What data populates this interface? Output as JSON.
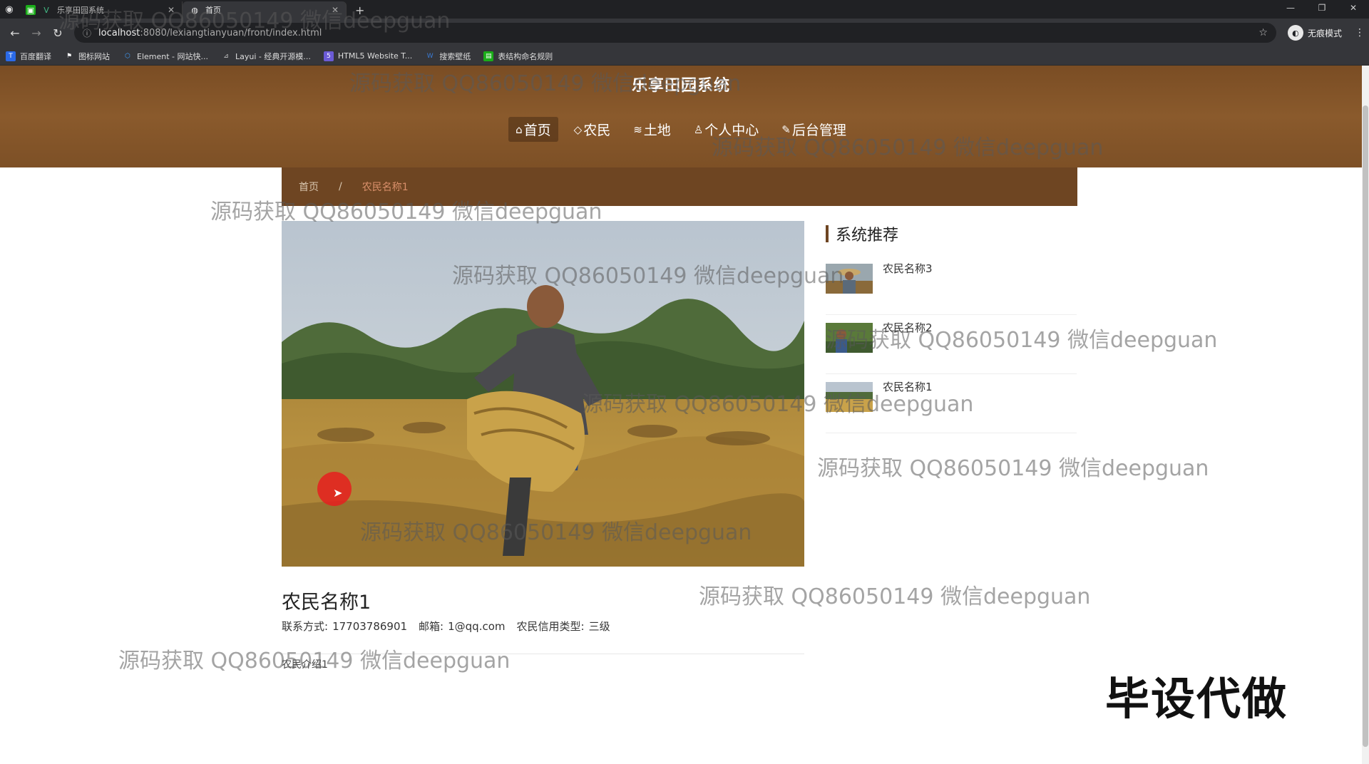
{
  "browser": {
    "tabs": [
      {
        "title": "乐享田园系统",
        "active": false
      },
      {
        "title": "首页",
        "active": true
      }
    ],
    "url_host": "localhost",
    "url_path": ":8080/lexiangtianyuan/front/index.html",
    "profile_label": "无痕模式",
    "bookmarks": [
      {
        "label": "百度翻译",
        "color": "#2a6ae8"
      },
      {
        "label": "图标网站",
        "color": "#444444"
      },
      {
        "label": "Element - 网站快...",
        "color": "#409eff"
      },
      {
        "label": "Layui - 经典开源模...",
        "color": "#555555"
      },
      {
        "label": "HTML5 Website T...",
        "color": "#6b5bd6"
      },
      {
        "label": "搜索壁纸",
        "color": "#3a7bd5"
      },
      {
        "label": "表结构命名规则",
        "color": "#1aad19"
      }
    ]
  },
  "site": {
    "title": "乐享田园系统",
    "nav": [
      {
        "icon": "⌂",
        "label": "首页",
        "active": true
      },
      {
        "icon": "◇",
        "label": "农民",
        "active": false
      },
      {
        "icon": "≋",
        "label": "土地",
        "active": false
      },
      {
        "icon": "♙",
        "label": "个人中心",
        "active": false
      },
      {
        "icon": "✎",
        "label": "后台管理",
        "active": false
      }
    ]
  },
  "breadcrumb": {
    "home": "首页",
    "separator": "/",
    "current": "农民名称1"
  },
  "detail": {
    "title": "农民名称1",
    "contact_label": "联系方式:",
    "contact_value": "17703786901",
    "email_label": "邮箱:",
    "email_value": "1@qq.com",
    "credit_label": "农民信用类型:",
    "credit_value": "三级",
    "intro": "农民介绍1"
  },
  "sidebar": {
    "heading": "系统推荐",
    "items": [
      {
        "name": "农民名称3"
      },
      {
        "name": "农民名称2"
      },
      {
        "name": "农民名称1"
      }
    ]
  },
  "watermark_text": "源码获取 QQ86050149 微信deepguan",
  "promo_text": "毕设代做",
  "colors": {
    "header_brown": "#8a5a2c",
    "breadcrumb_brown": "#6e4522"
  }
}
